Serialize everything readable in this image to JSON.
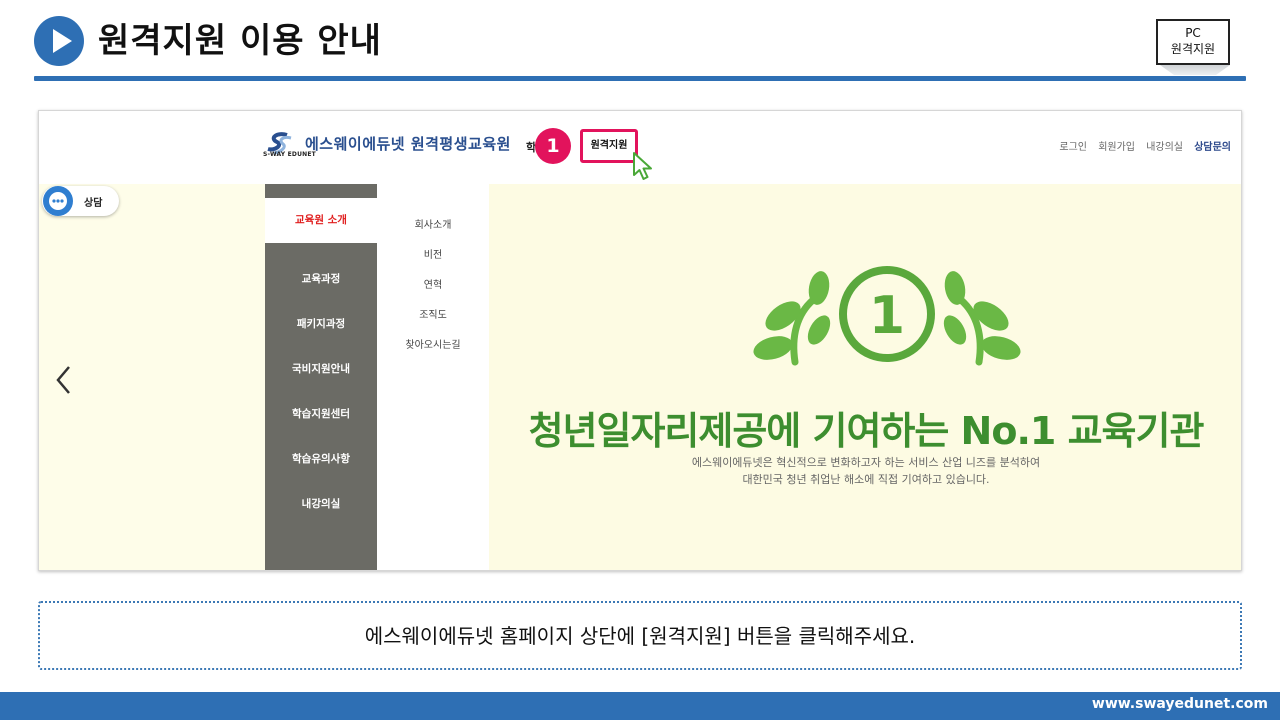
{
  "slide": {
    "title": "원격지원 이용 안내",
    "badge_line1": "PC",
    "badge_line2": "원격지원"
  },
  "site": {
    "logo_text": "에스웨이에듀넷 원격평생교육원",
    "logo_sub": "S-WAY EDUNET",
    "nav_partial": "학",
    "step_number": "1",
    "remote_support_button": "원격지원",
    "util_nav": [
      "로그인",
      "회원가입",
      "내강의실",
      "상담문의"
    ],
    "chat_label": "상담",
    "menu": [
      {
        "label": "교육원 소개",
        "active": true
      },
      {
        "label": "교육과정",
        "active": false
      },
      {
        "label": "패키지과정",
        "active": false
      },
      {
        "label": "국비지원안내",
        "active": false
      },
      {
        "label": "학습지원센터",
        "active": false
      },
      {
        "label": "학습유의사항",
        "active": false
      },
      {
        "label": "내강의실",
        "active": false
      }
    ],
    "submenu": [
      "회사소개",
      "비전",
      "연혁",
      "조직도",
      "찾아오시는길"
    ],
    "banner": {
      "emblem_number": "1",
      "headline": "청년일자리제공에 기여하는 No.1 교육기관",
      "desc_line1": "에스웨이에듀넷은 혁신적으로 변화하고자 하는 서비스 산업 니즈를 분석하여",
      "desc_line2": "대한민국 청년 취업난 해소에 직접 기여하고 있습니다."
    }
  },
  "instruction": "에스웨이에듀넷 홈페이지 상단에 [원격지원] 버튼을 클릭해주세요.",
  "footer": {
    "url": "www.swayedunet.com"
  },
  "colors": {
    "brand_blue": "#2e6fb4",
    "highlight_pink": "#e2135c",
    "banner_green": "#3d8e2f",
    "menu_gray": "#6b6b65",
    "active_red": "#e01e1e"
  },
  "icons": [
    "play-icon",
    "chat-icon",
    "chevron-left-icon",
    "cursor-icon",
    "laurel-emblem-icon"
  ]
}
